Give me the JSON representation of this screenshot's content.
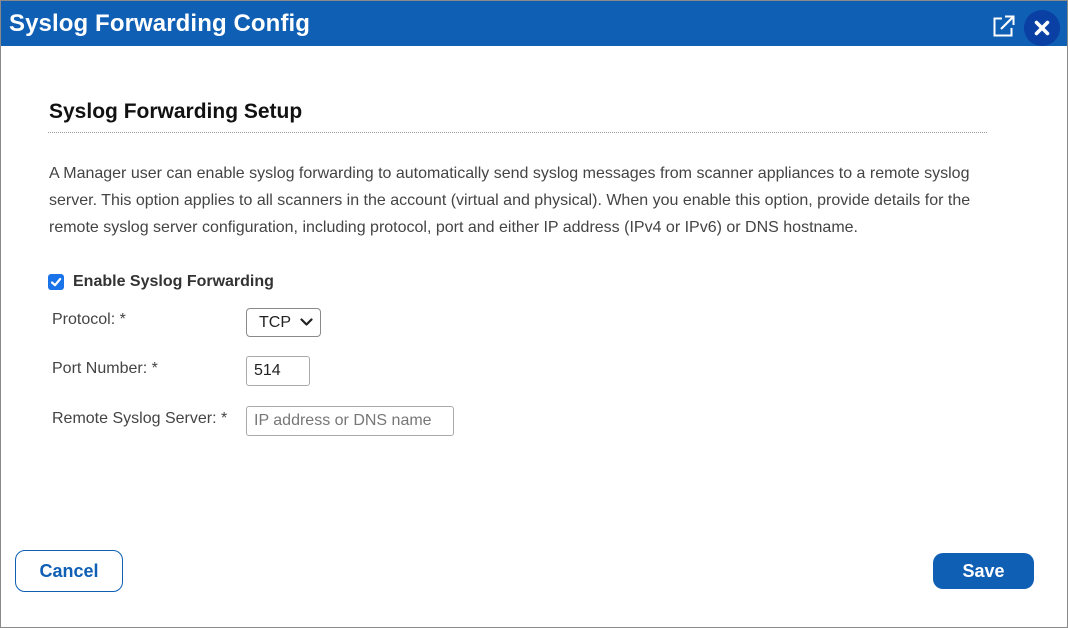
{
  "window": {
    "title": "Syslog Forwarding Config",
    "popout_icon": "popout-icon",
    "close_icon": "close-icon"
  },
  "section": {
    "title": "Syslog Forwarding Setup",
    "description": "A Manager user can enable syslog forwarding to automatically send syslog messages from scanner appliances to a remote syslog server. This option applies to all scanners in the account (virtual and physical). When you enable this option, provide details for the remote syslog server configuration, including protocol, port and either IP address (IPv4 or IPv6) or DNS hostname."
  },
  "form": {
    "enable_label": "Enable Syslog Forwarding",
    "enable_checked": true,
    "protocol_label": "Protocol: *",
    "protocol_value": "TCP",
    "port_label": "Port Number: *",
    "port_value": "514",
    "server_label": "Remote Syslog Server: *",
    "server_value": "",
    "server_placeholder": "IP address or DNS name"
  },
  "buttons": {
    "cancel": "Cancel",
    "save": "Save"
  },
  "colors": {
    "titlebar": "#0f5fb5",
    "close_button": "#0a3fa3",
    "checkbox": "#1a73e8",
    "primary": "#0f5fb5"
  }
}
